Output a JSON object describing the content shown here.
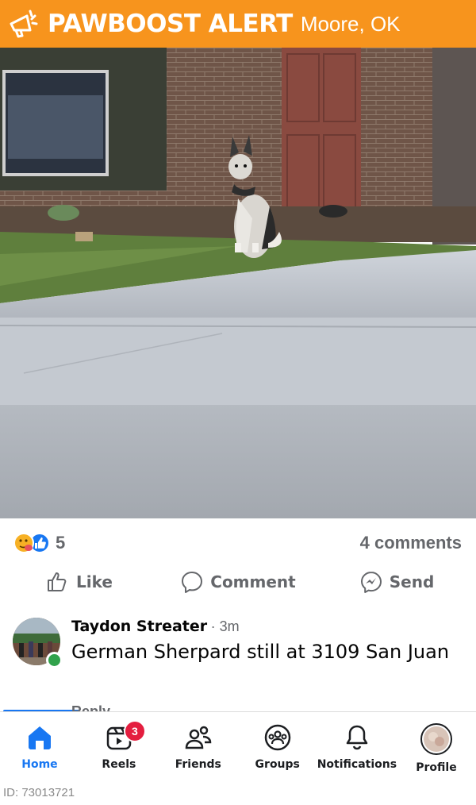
{
  "banner": {
    "brand": "PAWBOOST ALERT",
    "location": "Moore, OK",
    "color": "#f7941d",
    "icon": "megaphone-icon"
  },
  "post": {
    "reaction_count": "5",
    "comments_label": "4 comments",
    "actions": [
      {
        "label": "Like",
        "icon": "thumbs-up-icon"
      },
      {
        "label": "Comment",
        "icon": "comment-bubble-icon"
      },
      {
        "label": "Send",
        "icon": "messenger-icon"
      }
    ]
  },
  "comment": {
    "author": "Taydon Streater",
    "time": "· 3m",
    "text": "German Sherpard still at 3109 San Juan",
    "reply_label": "Reply"
  },
  "nav": {
    "items": [
      {
        "label": "Home",
        "icon": "home-icon",
        "active": true
      },
      {
        "label": "Reels",
        "icon": "reels-icon",
        "badge": "3"
      },
      {
        "label": "Friends",
        "icon": "friends-icon"
      },
      {
        "label": "Groups",
        "icon": "groups-icon"
      },
      {
        "label": "Notifications",
        "icon": "bell-icon"
      },
      {
        "label": "Profile",
        "icon": "profile-avatar"
      }
    ]
  },
  "footer": {
    "id_label": "ID: 73013721"
  },
  "colors": {
    "accent": "#1877f2",
    "badge": "#e41e3f",
    "online": "#31a24c"
  }
}
